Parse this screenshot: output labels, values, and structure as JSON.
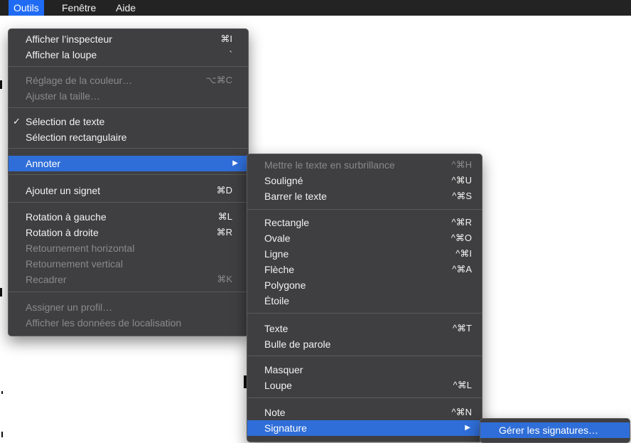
{
  "menubar": {
    "items": [
      "Outils",
      "Fenêtre",
      "Aide"
    ]
  },
  "outils_menu": {
    "groups": [
      [
        {
          "label": "Afficher l’inspecteur",
          "shortcut": "⌘I",
          "disabled": false
        },
        {
          "label": "Afficher la loupe",
          "shortcut": "`",
          "disabled": false
        }
      ],
      [
        {
          "label": "Réglage de la couleur…",
          "shortcut": "⌥⌘C",
          "disabled": true
        },
        {
          "label": "Ajuster la taille…",
          "shortcut": "",
          "disabled": true
        }
      ],
      [
        {
          "label": "Sélection de texte",
          "shortcut": "",
          "disabled": false,
          "checked": true
        },
        {
          "label": "Sélection rectangulaire",
          "shortcut": "",
          "disabled": false
        }
      ],
      [
        {
          "label": "Annoter",
          "shortcut": "",
          "disabled": false,
          "highlighted": true,
          "submenu": true
        }
      ],
      [
        {
          "label": "Ajouter un signet",
          "shortcut": "⌘D",
          "disabled": false
        }
      ],
      [
        {
          "label": "Rotation à gauche",
          "shortcut": "⌘L",
          "disabled": false
        },
        {
          "label": "Rotation à droite",
          "shortcut": "⌘R",
          "disabled": false
        },
        {
          "label": "Retournement horizontal",
          "shortcut": "",
          "disabled": true
        },
        {
          "label": "Retournement vertical",
          "shortcut": "",
          "disabled": true
        },
        {
          "label": "Recadrer",
          "shortcut": "⌘K",
          "disabled": true
        }
      ],
      [
        {
          "label": "Assigner un profil…",
          "shortcut": "",
          "disabled": true
        },
        {
          "label": "Afficher les données de localisation",
          "shortcut": "",
          "disabled": true
        }
      ]
    ]
  },
  "annoter_menu": {
    "groups": [
      [
        {
          "label": "Mettre le texte en surbrillance",
          "shortcut": "^⌘H",
          "disabled": true
        },
        {
          "label": "Souligné",
          "shortcut": "^⌘U",
          "disabled": false
        },
        {
          "label": "Barrer le texte",
          "shortcut": "^⌘S",
          "disabled": false
        }
      ],
      [
        {
          "label": "Rectangle",
          "shortcut": "^⌘R",
          "disabled": false
        },
        {
          "label": "Ovale",
          "shortcut": "^⌘O",
          "disabled": false
        },
        {
          "label": "Ligne",
          "shortcut": "^⌘I",
          "disabled": false
        },
        {
          "label": "Flèche",
          "shortcut": "^⌘A",
          "disabled": false
        },
        {
          "label": "Polygone",
          "shortcut": "",
          "disabled": false
        },
        {
          "label": "Étoile",
          "shortcut": "",
          "disabled": false
        }
      ],
      [
        {
          "label": "Texte",
          "shortcut": "^⌘T",
          "disabled": false
        },
        {
          "label": "Bulle de parole",
          "shortcut": "",
          "disabled": false
        }
      ],
      [
        {
          "label": "Masquer",
          "shortcut": "",
          "disabled": false
        },
        {
          "label": "Loupe",
          "shortcut": "^⌘L",
          "disabled": false
        }
      ],
      [
        {
          "label": "Note",
          "shortcut": "^⌘N",
          "disabled": false
        },
        {
          "label": "Signature",
          "shortcut": "",
          "disabled": false,
          "highlighted": true,
          "submenu": true
        }
      ]
    ]
  },
  "signature_menu": {
    "items": [
      {
        "label": "Gérer les signatures…",
        "highlighted": true
      }
    ]
  },
  "colors": {
    "menu_bg": "#3f3f41",
    "highlight": "#2f6ed8",
    "menubar_bg": "#232323",
    "disabled_text": "#8a8a8c"
  }
}
